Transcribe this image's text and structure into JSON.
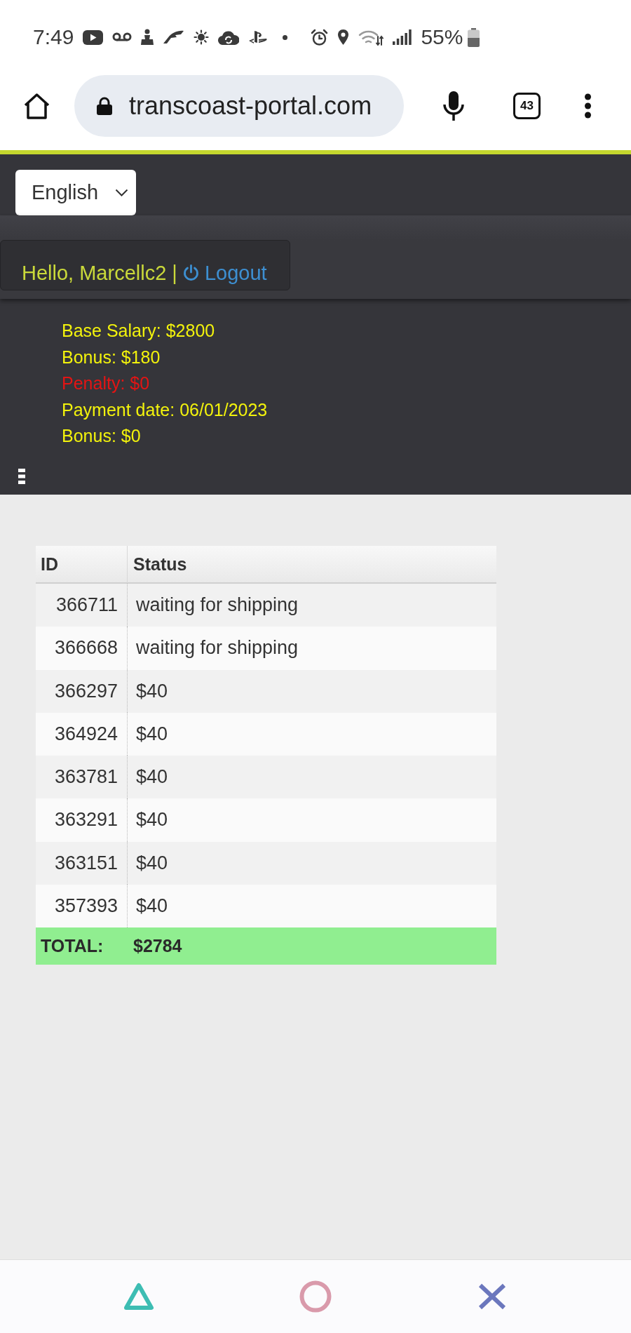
{
  "status_bar": {
    "time": "7:49",
    "battery": "55%"
  },
  "browser": {
    "url": "transcoast-portal.com",
    "tab_count": "43"
  },
  "header": {
    "language": "English",
    "greeting": "Hello, Marcellc2 |",
    "logout": "Logout",
    "summary": [
      {
        "text": "Base Salary: $2800",
        "kind": "info"
      },
      {
        "text": "Bonus: $180",
        "kind": "info"
      },
      {
        "text": "Penalty: $0",
        "kind": "penalty"
      },
      {
        "text": "Payment date: 06/01/2023",
        "kind": "info"
      },
      {
        "text": "Bonus: $0",
        "kind": "info"
      }
    ]
  },
  "table": {
    "columns": [
      "ID",
      "Status"
    ],
    "rows": [
      {
        "id": "366711",
        "status": "waiting for shipping"
      },
      {
        "id": "366668",
        "status": "waiting for shipping"
      },
      {
        "id": "366297",
        "status": "$40"
      },
      {
        "id": "364924",
        "status": "$40"
      },
      {
        "id": "363781",
        "status": "$40"
      },
      {
        "id": "363291",
        "status": "$40"
      },
      {
        "id": "363151",
        "status": "$40"
      },
      {
        "id": "357393",
        "status": "$40"
      }
    ],
    "total": {
      "label": "TOTAL:",
      "value": "$2784"
    }
  }
}
